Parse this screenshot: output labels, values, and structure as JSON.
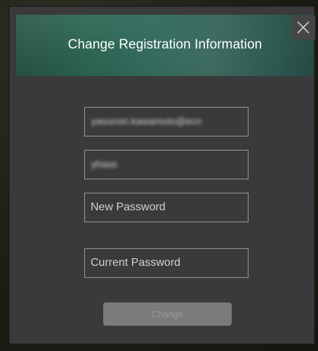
{
  "dialog": {
    "title": "Change Registration Information",
    "close_icon": "close-icon"
  },
  "form": {
    "email_value": "yasunori.kawamoto@ecn",
    "name_value": "yhass",
    "new_password_placeholder": "New Password",
    "current_password_placeholder": "Current Password",
    "change_button_label": "Change"
  }
}
